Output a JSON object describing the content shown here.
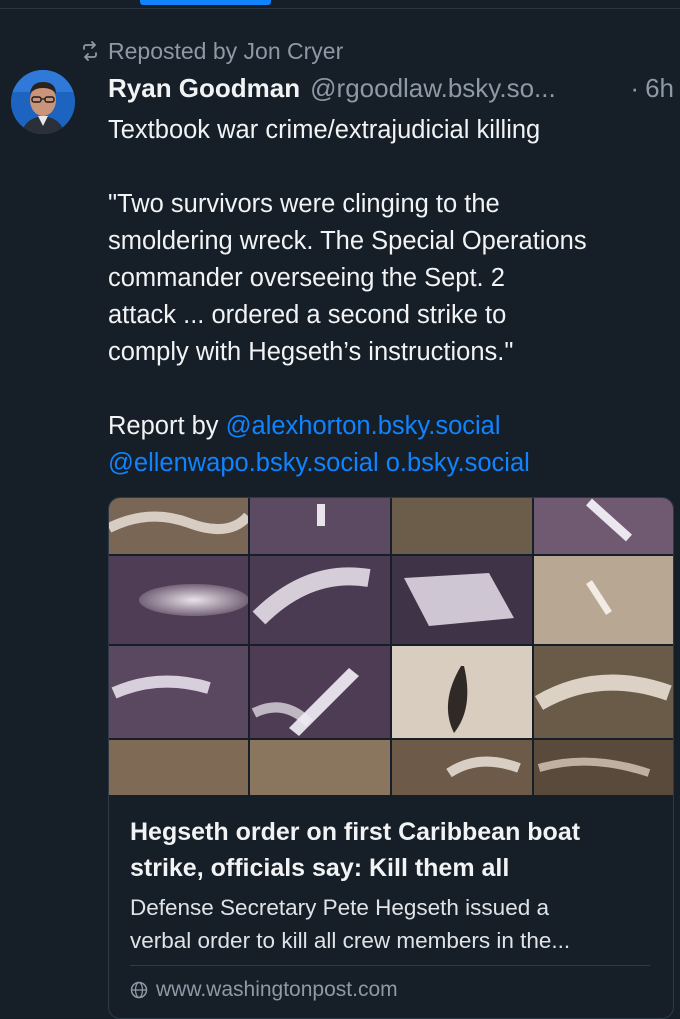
{
  "repost": {
    "icon": "repost-icon",
    "text": "Reposted by Jon Cryer"
  },
  "post": {
    "author_name": "Ryan Goodman",
    "handle": "@rgoodlaw.bsky.so...",
    "dot": "·",
    "time": "6h",
    "line1": "Textbook war crime/extrajudicial killing",
    "quote_lines": [
      "\"Two survivors were clinging to the",
      "smoldering wreck. The Special Operations",
      "commander overseeing the Sept. 2",
      "attack ... ordered a second strike to",
      "comply with Hegseth’s instructions.\""
    ],
    "report_prefix": "Report by ",
    "mention1": "@alexhorton.bsky.social",
    "mention2": "@ellenwapo.bsky.social",
    "mention3": "o.bsky.social"
  },
  "card": {
    "title_line1": "Hegseth order on first Caribbean boat",
    "title_line2": "strike, officials say: Kill them all",
    "desc_line1": "Defense Secretary Pete Hegseth issued a",
    "desc_line2": "verbal order to kill all crew members in the...",
    "url": "www.washingtonpost.com",
    "url_icon": "globe-icon"
  },
  "colors": {
    "background": "#161e27",
    "accent": "#1083fe",
    "muted": "#8d99a6",
    "text": "#f1f3f5"
  }
}
